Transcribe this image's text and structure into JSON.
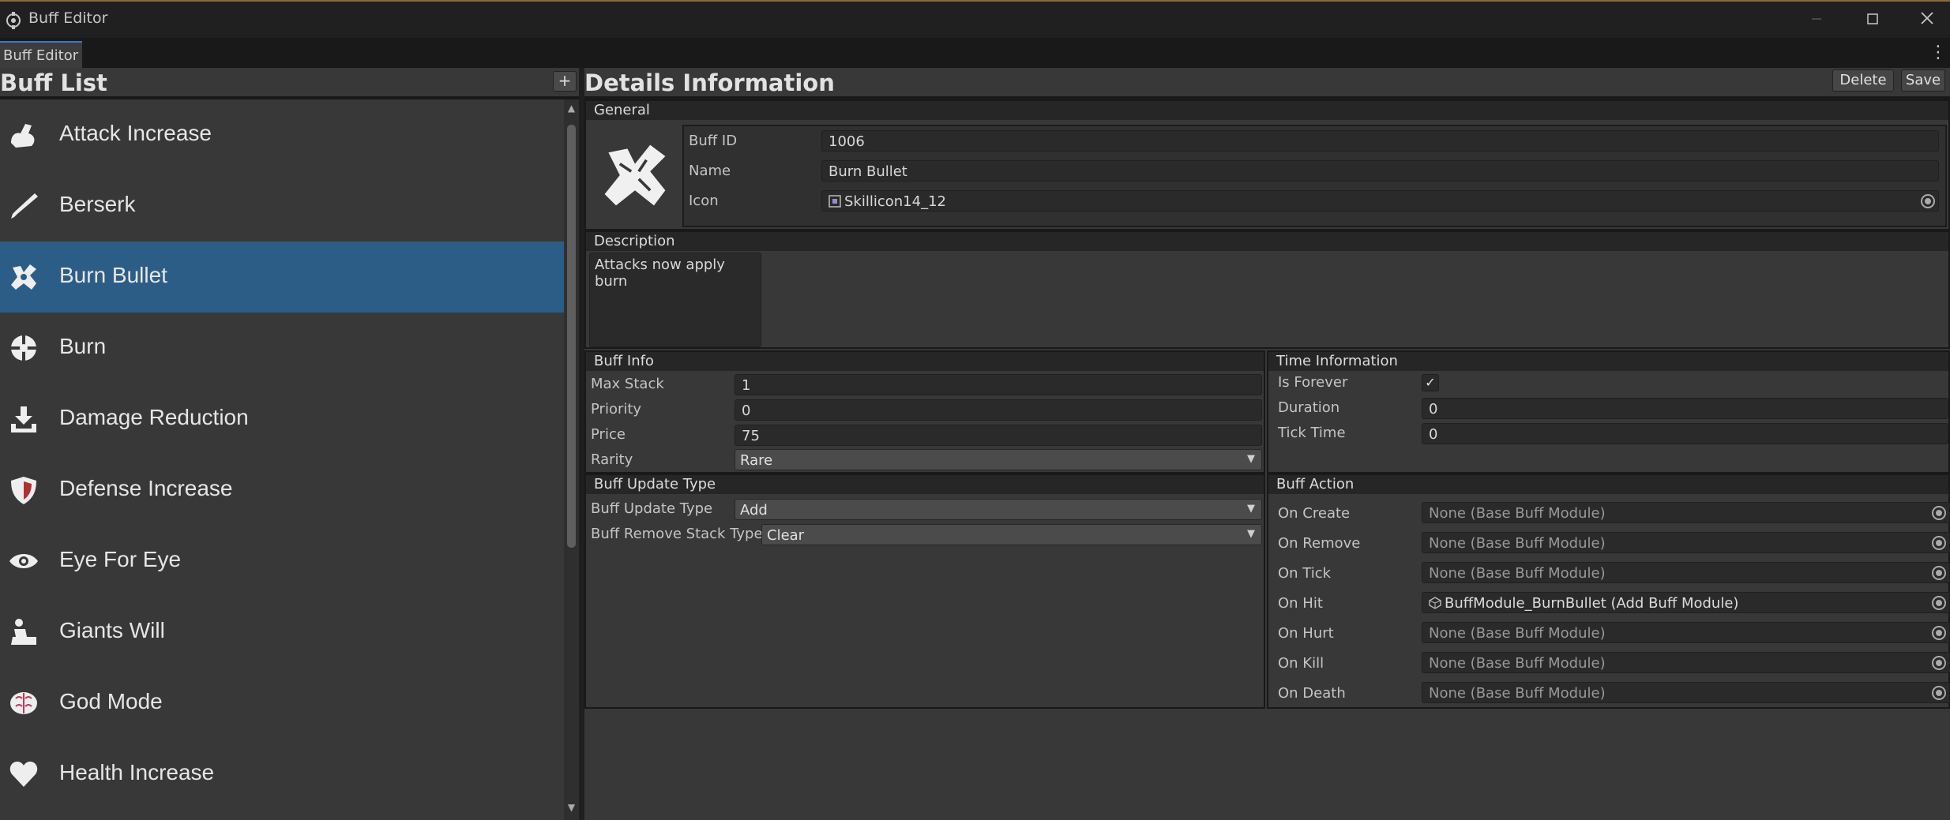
{
  "window": {
    "title": "Buff Editor"
  },
  "tab": {
    "label": "Buff Editor"
  },
  "buff_list": {
    "title": "Buff List",
    "add_label": "+",
    "items": [
      {
        "label": "Attack Increase",
        "icon": "flexed-arm-icon"
      },
      {
        "label": "Berserk",
        "icon": "blade-icon"
      },
      {
        "label": "Burn Bullet",
        "icon": "burn-bullet-icon",
        "selected": true
      },
      {
        "label": "Burn",
        "icon": "crosshair-icon"
      },
      {
        "label": "Damage Reduction",
        "icon": "download-tray-icon"
      },
      {
        "label": "Defense Increase",
        "icon": "shield-icon"
      },
      {
        "label": "Eye For Eye",
        "icon": "eye-icon"
      },
      {
        "label": "Giants Will",
        "icon": "giant-icon"
      },
      {
        "label": "God Mode",
        "icon": "brain-icon"
      },
      {
        "label": "Health Increase",
        "icon": "heart-icon"
      }
    ]
  },
  "details": {
    "title": "Details Information",
    "delete_label": "Delete",
    "save_label": "Save",
    "general": {
      "title": "General",
      "buff_id_label": "Buff ID",
      "buff_id": "1006",
      "name_label": "Name",
      "name": "Burn Bullet",
      "icon_label": "Icon",
      "icon_value": "Skillicon14_12"
    },
    "description": {
      "title": "Description",
      "text": "Attacks now apply burn"
    },
    "buff_info": {
      "title": "Buff Info",
      "max_stack_label": "Max Stack",
      "max_stack": "1",
      "priority_label": "Priority",
      "priority": "0",
      "price_label": "Price",
      "price": "75",
      "rarity_label": "Rarity",
      "rarity": "Rare"
    },
    "time_info": {
      "title": "Time Information",
      "is_forever_label": "Is Forever",
      "is_forever_check": "✓",
      "duration_label": "Duration",
      "duration": "0",
      "tick_time_label": "Tick Time",
      "tick_time": "0"
    },
    "update_type": {
      "title": "Buff Update Type",
      "update_label": "Buff Update Type",
      "update_value": "Add",
      "remove_label": "Buff Remove Stack Type",
      "remove_value": "Clear"
    },
    "buff_action": {
      "title": "Buff Action",
      "rows": [
        {
          "label": "On Create",
          "value": "None (Base Buff Module)"
        },
        {
          "label": "On Remove",
          "value": "None (Base Buff Module)"
        },
        {
          "label": "On Tick",
          "value": "None (Base Buff Module)"
        },
        {
          "label": "On Hit",
          "value": "BuffModule_BurnBullet (Add Buff Module)"
        },
        {
          "label": "On Hurt",
          "value": "None (Base Buff Module)"
        },
        {
          "label": "On Kill",
          "value": "None (Base Buff Module)"
        },
        {
          "label": "On Death",
          "value": "None (Base Buff Module)"
        }
      ]
    }
  },
  "colors": {
    "selection": "#2c5d87",
    "panel": "#383838",
    "header": "#262626",
    "accent_tab": "#3b78c2"
  }
}
